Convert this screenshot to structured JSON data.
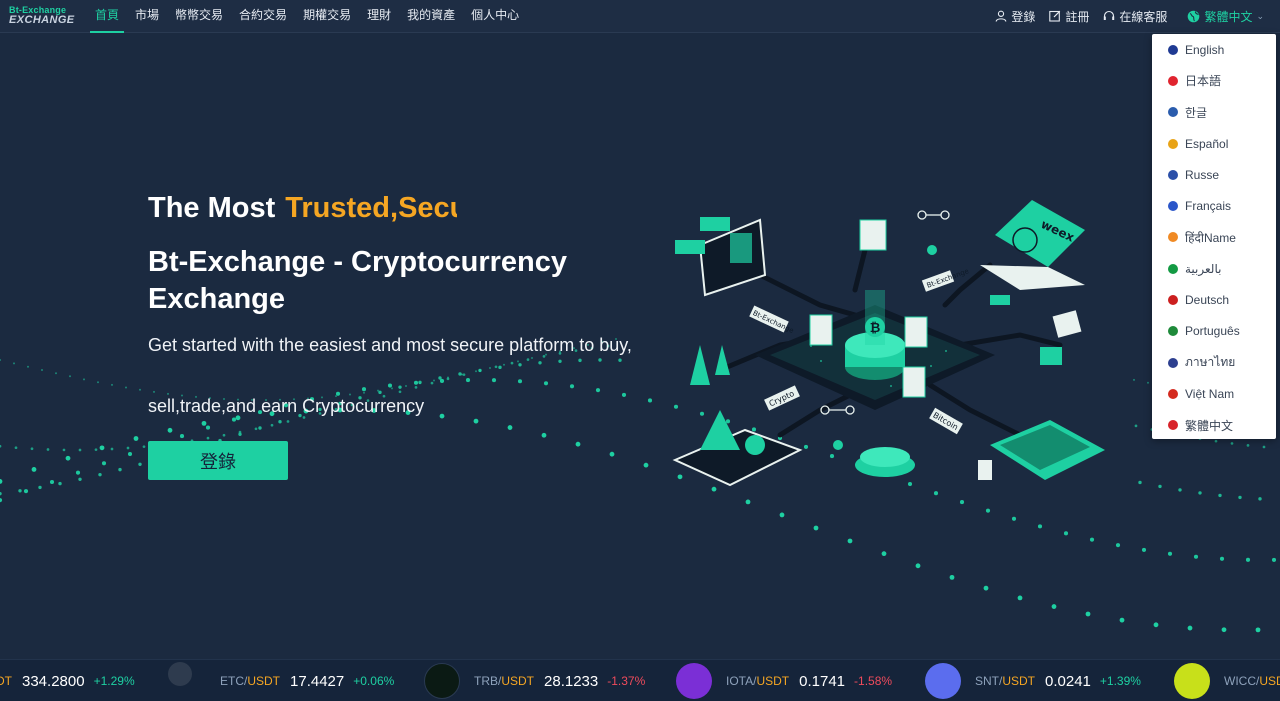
{
  "brand": {
    "line1": "Bt-Exchange",
    "line2": "EXCHANGE"
  },
  "nav": {
    "items": [
      {
        "label": "首頁",
        "active": true
      },
      {
        "label": "市場"
      },
      {
        "label": "幣幣交易"
      },
      {
        "label": "合約交易"
      },
      {
        "label": "期權交易"
      },
      {
        "label": "理財"
      },
      {
        "label": "我的資產"
      },
      {
        "label": "個人中心"
      }
    ],
    "login": "登錄",
    "register": "註冊",
    "support": "在線客服",
    "language": "繁體中文"
  },
  "hero": {
    "line1_prefix": "The Most",
    "line1_highlight": "Trusted,Secu",
    "title": "Bt-Exchange - Cryptocurrency Exchange",
    "subtitle1": "Get started with the easiest and most secure platform to buy,",
    "subtitle2": "sell,trade,and earn Cryptocurrency",
    "button": "登錄"
  },
  "illustration": {
    "labels": [
      "weex",
      "Bt-Exchange",
      "Bt-Exchange",
      "Crypto",
      "Bitcoin"
    ]
  },
  "languages": [
    {
      "label": "English",
      "color": "#1f3a93"
    },
    {
      "label": "日本語",
      "color": "#e0242f"
    },
    {
      "label": "한글",
      "color": "#2a5cad"
    },
    {
      "label": "Español",
      "color": "#e8a317"
    },
    {
      "label": "Russe",
      "color": "#2b4fa8"
    },
    {
      "label": "Français",
      "color": "#2b56c9"
    },
    {
      "label": "हिंदीName",
      "color": "#f08a24"
    },
    {
      "label": "بالعربية",
      "color": "#139a43"
    },
    {
      "label": "Deutsch",
      "color": "#cc1f1f"
    },
    {
      "label": "Português",
      "color": "#1e8a3a"
    },
    {
      "label": "ภาษาไทย",
      "color": "#2d3f8f"
    },
    {
      "label": "Việt Nam",
      "color": "#d42a1f"
    },
    {
      "label": "繁體中文",
      "color": "#d8232a"
    }
  ],
  "ticker": [
    {
      "base": "",
      "quote": "DT",
      "price": "334.2800",
      "change": "+1.29%",
      "dir": "up",
      "coin_color": ""
    },
    {
      "base": "ETC",
      "quote": "USDT",
      "price": "17.4427",
      "change": "+0.06%",
      "dir": "up",
      "coin_color": "#2e3b4e"
    },
    {
      "base": "TRB",
      "quote": "USDT",
      "price": "28.1233",
      "change": "-1.37%",
      "dir": "down",
      "coin_color": "#0b1a14"
    },
    {
      "base": "IOTA",
      "quote": "USDT",
      "price": "0.1741",
      "change": "-1.58%",
      "dir": "down",
      "coin_color": "#7b2fd6"
    },
    {
      "base": "SNT",
      "quote": "USDT",
      "price": "0.0241",
      "change": "+1.39%",
      "dir": "up",
      "coin_color": "#5b6dee"
    },
    {
      "base": "WICC",
      "quote": "USDT",
      "price": "",
      "change": "",
      "dir": "up",
      "coin_color": "#c8e01a"
    }
  ]
}
